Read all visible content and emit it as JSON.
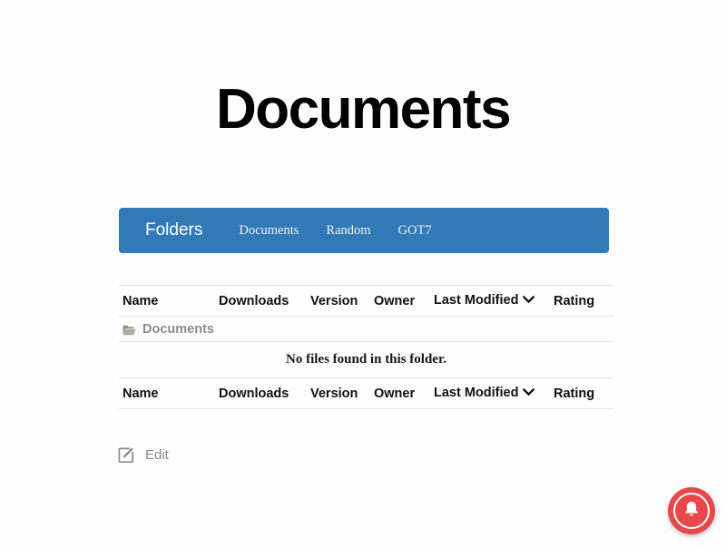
{
  "page": {
    "title": "Documents",
    "background_color": "#fefefe"
  },
  "navbar": {
    "background_color": "#3279b7",
    "brand": "Folders",
    "links": [
      {
        "label": "Documents"
      },
      {
        "label": "Random"
      },
      {
        "label": "GOT7"
      }
    ]
  },
  "table": {
    "columns": [
      {
        "label": "Name"
      },
      {
        "label": "Downloads"
      },
      {
        "label": "Version"
      },
      {
        "label": "Owner"
      },
      {
        "label": "Last Modified",
        "sort_icon": "chevron-down-icon"
      },
      {
        "label": "Rating"
      }
    ],
    "folder_row": {
      "icon": "folder-icon",
      "label": "Documents"
    },
    "empty_message": "No files found in this folder.",
    "footer_columns": [
      {
        "label": "Name"
      },
      {
        "label": "Downloads"
      },
      {
        "label": "Version"
      },
      {
        "label": "Owner"
      },
      {
        "label": "Last Modified",
        "sort_icon": "chevron-down-icon"
      },
      {
        "label": "Rating"
      }
    ]
  },
  "actions": {
    "edit": {
      "icon": "edit-pencil-square-icon",
      "label": "Edit"
    }
  },
  "notification_widget": {
    "icon": "bell-icon",
    "color": "#e8474c"
  }
}
